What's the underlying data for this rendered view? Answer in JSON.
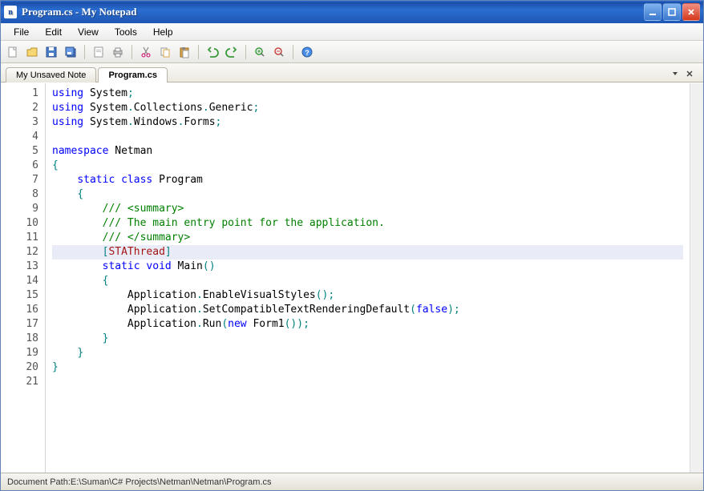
{
  "window": {
    "title": "Program.cs - My Notepad",
    "icon_letter": "n"
  },
  "menu": {
    "items": [
      "File",
      "Edit",
      "View",
      "Tools",
      "Help"
    ]
  },
  "tabs": {
    "items": [
      {
        "label": "My Unsaved Note",
        "active": false
      },
      {
        "label": "Program.cs",
        "active": true
      }
    ]
  },
  "editor": {
    "highlighted_line": 12,
    "lines": [
      {
        "n": 1,
        "tokens": [
          [
            "kw",
            "using"
          ],
          [
            "",
            " System"
          ],
          [
            "punct",
            ";"
          ]
        ]
      },
      {
        "n": 2,
        "tokens": [
          [
            "kw",
            "using"
          ],
          [
            "",
            " System"
          ],
          [
            "punct",
            "."
          ],
          [
            "",
            "Collections"
          ],
          [
            "punct",
            "."
          ],
          [
            "",
            "Generic"
          ],
          [
            "punct",
            ";"
          ]
        ]
      },
      {
        "n": 3,
        "tokens": [
          [
            "kw",
            "using"
          ],
          [
            "",
            " System"
          ],
          [
            "punct",
            "."
          ],
          [
            "",
            "Windows"
          ],
          [
            "punct",
            "."
          ],
          [
            "",
            "Forms"
          ],
          [
            "punct",
            ";"
          ]
        ]
      },
      {
        "n": 4,
        "tokens": []
      },
      {
        "n": 5,
        "tokens": [
          [
            "kw",
            "namespace"
          ],
          [
            "",
            " Netman"
          ]
        ]
      },
      {
        "n": 6,
        "tokens": [
          [
            "punct",
            "{"
          ]
        ]
      },
      {
        "n": 7,
        "tokens": [
          [
            "",
            "    "
          ],
          [
            "kw",
            "static"
          ],
          [
            "",
            " "
          ],
          [
            "kw",
            "class"
          ],
          [
            "",
            " Program"
          ]
        ]
      },
      {
        "n": 8,
        "tokens": [
          [
            "",
            "    "
          ],
          [
            "punct",
            "{"
          ]
        ]
      },
      {
        "n": 9,
        "tokens": [
          [
            "",
            "        "
          ],
          [
            "cmt",
            "/// <summary>"
          ]
        ]
      },
      {
        "n": 10,
        "tokens": [
          [
            "",
            "        "
          ],
          [
            "cmt",
            "/// The main entry point for the application."
          ]
        ]
      },
      {
        "n": 11,
        "tokens": [
          [
            "",
            "        "
          ],
          [
            "cmt",
            "/// </summary>"
          ]
        ]
      },
      {
        "n": 12,
        "tokens": [
          [
            "",
            "        "
          ],
          [
            "punct",
            "["
          ],
          [
            "attr",
            "STAThread"
          ],
          [
            "punct",
            "]"
          ]
        ]
      },
      {
        "n": 13,
        "tokens": [
          [
            "",
            "        "
          ],
          [
            "kw",
            "static"
          ],
          [
            "",
            " "
          ],
          [
            "kw",
            "void"
          ],
          [
            "",
            " Main"
          ],
          [
            "punct",
            "()"
          ]
        ]
      },
      {
        "n": 14,
        "tokens": [
          [
            "",
            "        "
          ],
          [
            "punct",
            "{"
          ]
        ]
      },
      {
        "n": 15,
        "tokens": [
          [
            "",
            "            Application"
          ],
          [
            "punct",
            "."
          ],
          [
            "",
            "EnableVisualStyles"
          ],
          [
            "punct",
            "();"
          ]
        ]
      },
      {
        "n": 16,
        "tokens": [
          [
            "",
            "            Application"
          ],
          [
            "punct",
            "."
          ],
          [
            "",
            "SetCompatibleTextRenderingDefault"
          ],
          [
            "punct",
            "("
          ],
          [
            "kw",
            "false"
          ],
          [
            "punct",
            ");"
          ]
        ]
      },
      {
        "n": 17,
        "tokens": [
          [
            "",
            "            Application"
          ],
          [
            "punct",
            "."
          ],
          [
            "",
            "Run"
          ],
          [
            "punct",
            "("
          ],
          [
            "kw",
            "new"
          ],
          [
            "",
            " Form1"
          ],
          [
            "punct",
            "());"
          ]
        ]
      },
      {
        "n": 18,
        "tokens": [
          [
            "",
            "        "
          ],
          [
            "punct",
            "}"
          ]
        ]
      },
      {
        "n": 19,
        "tokens": [
          [
            "",
            "    "
          ],
          [
            "punct",
            "}"
          ]
        ]
      },
      {
        "n": 20,
        "tokens": [
          [
            "punct",
            "}"
          ]
        ]
      },
      {
        "n": 21,
        "tokens": []
      }
    ]
  },
  "statusbar": {
    "path_label": "Document Path: ",
    "path_value": "E:\\Suman\\C# Projects\\Netman\\Netman\\Program.cs"
  },
  "colors": {
    "kw": "#0000ff",
    "cmt": "#008000",
    "attr": "#a31515",
    "punct": "#008080",
    "highlight": "#e9ecf6"
  }
}
